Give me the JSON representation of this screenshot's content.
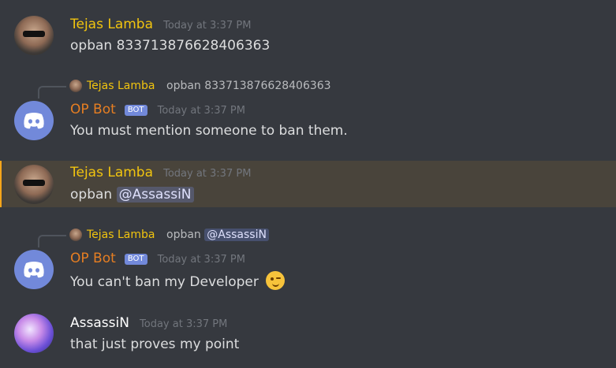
{
  "messages": [
    {
      "author": "Tejas Lamba",
      "time": "Today at 3:37 PM",
      "text": "opban 833713876628406363"
    },
    {
      "reply": {
        "author": "Tejas Lamba",
        "text": "opban 833713876628406363"
      },
      "author": "OP Bot",
      "badge": "BOT",
      "time": "Today at 3:37 PM",
      "text": "You must mention someone to ban them."
    },
    {
      "author": "Tejas Lamba",
      "time": "Today at 3:37 PM",
      "text": "opban",
      "mention": "@AssassiN"
    },
    {
      "reply": {
        "author": "Tejas Lamba",
        "text": "opban",
        "mention": "@AssassiN"
      },
      "author": "OP Bot",
      "badge": "BOT",
      "time": "Today at 3:37 PM",
      "text": "You can't ban my Developer",
      "emoji": "wink-emoji"
    },
    {
      "author": "AssassiN",
      "time": "Today at 3:37 PM",
      "text": "that just proves my point"
    }
  ],
  "colors": {
    "background": "#36393f",
    "tejas": "#f1c40f",
    "bot": "#e67e22",
    "badge": "#7289da",
    "highlight_bar": "#faa61a"
  }
}
